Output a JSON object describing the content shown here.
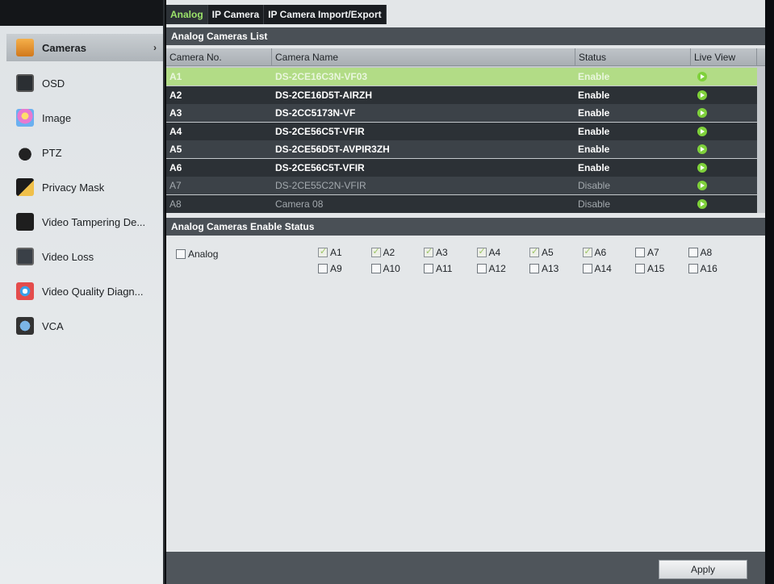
{
  "tabs": [
    "Analog",
    "IP Camera",
    "IP Camera Import/Export"
  ],
  "sidebar": {
    "items": [
      {
        "label": "Cameras",
        "icon": "camera-icon",
        "active": true
      },
      {
        "label": "OSD",
        "icon": "osd-icon"
      },
      {
        "label": "Image",
        "icon": "image-icon"
      },
      {
        "label": "PTZ",
        "icon": "ptz-icon"
      },
      {
        "label": "Privacy Mask",
        "icon": "privacy-mask-icon"
      },
      {
        "label": "Video Tampering De...",
        "icon": "video-tampering-icon"
      },
      {
        "label": "Video Loss",
        "icon": "video-loss-icon"
      },
      {
        "label": "Video Quality Diagn...",
        "icon": "video-quality-icon"
      },
      {
        "label": "VCA",
        "icon": "vca-icon"
      }
    ],
    "chevron": "›"
  },
  "list": {
    "title": "Analog Cameras List",
    "columns": [
      "Camera No.",
      "Camera Name",
      "Status",
      "Live View"
    ],
    "rows": [
      {
        "no": "A1",
        "name": "DS-2CE16C3N-VF03",
        "status": "Enable"
      },
      {
        "no": "A2",
        "name": "DS-2CE16D5T-AIRZH",
        "status": "Enable"
      },
      {
        "no": "A3",
        "name": "DS-2CC5173N-VF",
        "status": "Enable"
      },
      {
        "no": "A4",
        "name": "DS-2CE56C5T-VFIR",
        "status": "Enable"
      },
      {
        "no": "A5",
        "name": "DS-2CE56D5T-AVPIR3ZH",
        "status": "Enable"
      },
      {
        "no": "A6",
        "name": "DS-2CE56C5T-VFIR",
        "status": "Enable"
      },
      {
        "no": "A7",
        "name": "DS-2CE55C2N-VFIR",
        "status": "Disable"
      },
      {
        "no": "A8",
        "name": "Camera 08",
        "status": "Disable"
      }
    ]
  },
  "enable_status": {
    "title": "Analog Cameras Enable Status",
    "master_label": "Analog",
    "channels": [
      {
        "label": "A1",
        "checked": true
      },
      {
        "label": "A2",
        "checked": true
      },
      {
        "label": "A3",
        "checked": true
      },
      {
        "label": "A4",
        "checked": true
      },
      {
        "label": "A5",
        "checked": true
      },
      {
        "label": "A6",
        "checked": true
      },
      {
        "label": "A7",
        "checked": false
      },
      {
        "label": "A8",
        "checked": false
      },
      {
        "label": "A9",
        "checked": false
      },
      {
        "label": "A10",
        "checked": false
      },
      {
        "label": "A11",
        "checked": false
      },
      {
        "label": "A12",
        "checked": false
      },
      {
        "label": "A13",
        "checked": false
      },
      {
        "label": "A14",
        "checked": false
      },
      {
        "label": "A15",
        "checked": false
      },
      {
        "label": "A16",
        "checked": false
      }
    ]
  },
  "footer": {
    "apply_label": "Apply"
  },
  "colors": {
    "accent_green": "#9be36a",
    "selected_row": "#b2dc86",
    "live_icon": "#7fd13b"
  }
}
